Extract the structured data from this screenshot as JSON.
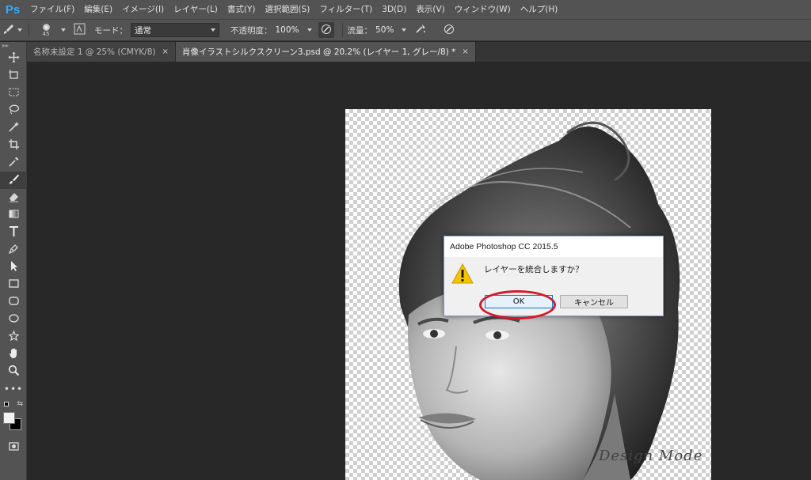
{
  "app": {
    "logo": "Ps"
  },
  "menu": [
    "ファイル(F)",
    "編集(E)",
    "イメージ(I)",
    "レイヤー(L)",
    "書式(Y)",
    "選択範囲(S)",
    "フィルター(T)",
    "3D(D)",
    "表示(V)",
    "ウィンドウ(W)",
    "ヘルプ(H)"
  ],
  "options": {
    "brush_size": "45",
    "mode_label": "モード：",
    "mode_value": "通常",
    "opacity_label": "不透明度：",
    "opacity_value": "100%",
    "flow_label": "流量：",
    "flow_value": "50%"
  },
  "tabs": [
    {
      "label": "名称未設定 1 @ 25% (CMYK/8)",
      "close": "×"
    },
    {
      "label": "肖像イラストシルクスクリーン3.psd @ 20.2% (レイヤー 1, グレー/8) *",
      "close": "×"
    }
  ],
  "dialog": {
    "title": "Adobe Photoshop CC 2015.5",
    "message": "レイヤーを統合しますか？",
    "ok_label": "OK",
    "cancel_label": "キャンセル"
  },
  "canvas": {
    "signature": "Design Mode"
  },
  "colors": {
    "accent": "#31a8ff",
    "highlight_ring": "#d4192b",
    "warning": "#f5c400"
  }
}
